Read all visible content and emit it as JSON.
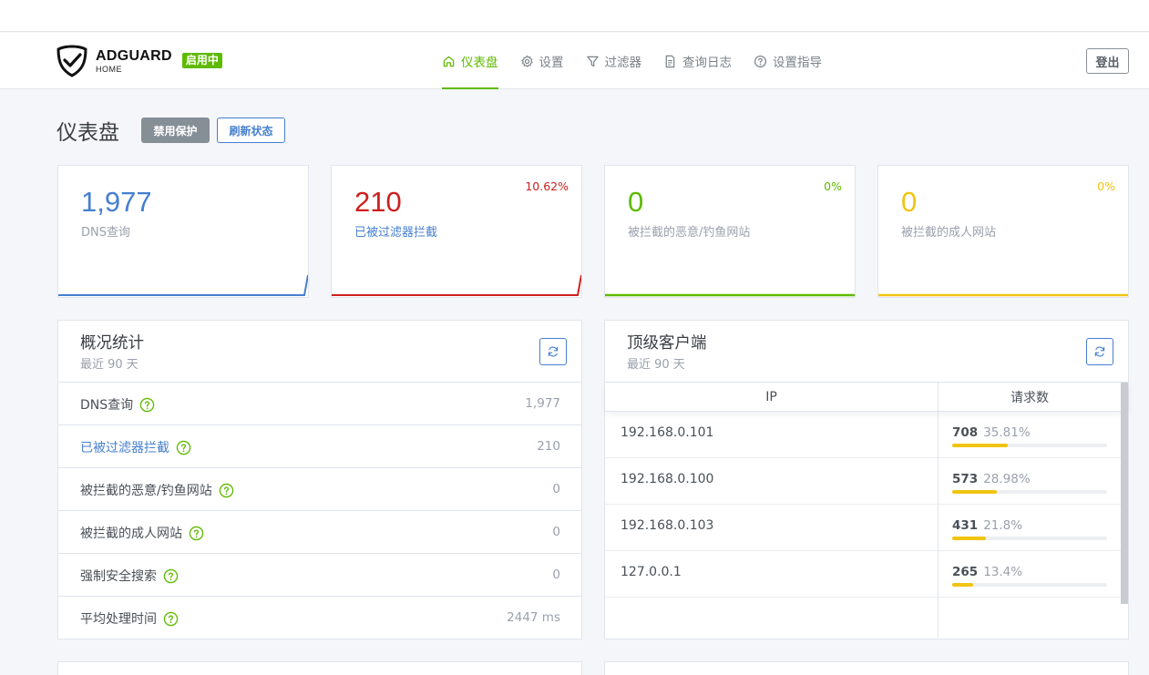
{
  "app": {
    "brand": "ADGUARD",
    "brand_sub": "HOME",
    "status": "启用中"
  },
  "nav": [
    {
      "label": "仪表盘",
      "icon": "home-icon",
      "active": true
    },
    {
      "label": "设置",
      "icon": "gear-icon",
      "active": false
    },
    {
      "label": "过滤器",
      "icon": "filter-icon",
      "active": false
    },
    {
      "label": "查询日志",
      "icon": "document-icon",
      "active": false
    },
    {
      "label": "设置指导",
      "icon": "help-circle-icon",
      "active": false
    }
  ],
  "header": {
    "logout_label": "登出"
  },
  "page": {
    "title": "仪表盘",
    "disable_label": "禁用保护",
    "refresh_label": "刷新状态"
  },
  "cards": [
    {
      "value": "1,977",
      "label": "DNS查询",
      "percent": "",
      "color": "#467fcf"
    },
    {
      "value": "210",
      "label": "已被过滤器拦截",
      "percent": "10.62%",
      "color": "#cd201f"
    },
    {
      "value": "0",
      "label": "被拦截的恶意/钓鱼网站",
      "percent": "0%",
      "color": "#5eba00"
    },
    {
      "value": "0",
      "label": "被拦截的成人网站",
      "percent": "0%",
      "color": "#f1c40f"
    }
  ],
  "stats": {
    "title": "概况统计",
    "subtitle": "最近 90 天",
    "rows": [
      {
        "label": "DNS查询",
        "value": "1,977"
      },
      {
        "label": "已被过滤器拦截",
        "value": "210"
      },
      {
        "label": "被拦截的恶意/钓鱼网站",
        "value": "0"
      },
      {
        "label": "被拦截的成人网站",
        "value": "0"
      },
      {
        "label": "强制安全搜索",
        "value": "0"
      },
      {
        "label": "平均处理时间",
        "value": "2447 ms"
      }
    ]
  },
  "clients": {
    "title": "顶级客户端",
    "subtitle": "最近 90 天",
    "columns": [
      "IP",
      "请求数"
    ],
    "rows": [
      {
        "ip": "192.168.0.101",
        "count": "708",
        "percent": "35.81%",
        "fraction": 0.3581
      },
      {
        "ip": "192.168.0.100",
        "count": "573",
        "percent": "28.98%",
        "fraction": 0.2898
      },
      {
        "ip": "192.168.0.103",
        "count": "431",
        "percent": "21.8%",
        "fraction": 0.218
      },
      {
        "ip": "127.0.0.1",
        "count": "265",
        "percent": "13.4%",
        "fraction": 0.134
      }
    ]
  }
}
